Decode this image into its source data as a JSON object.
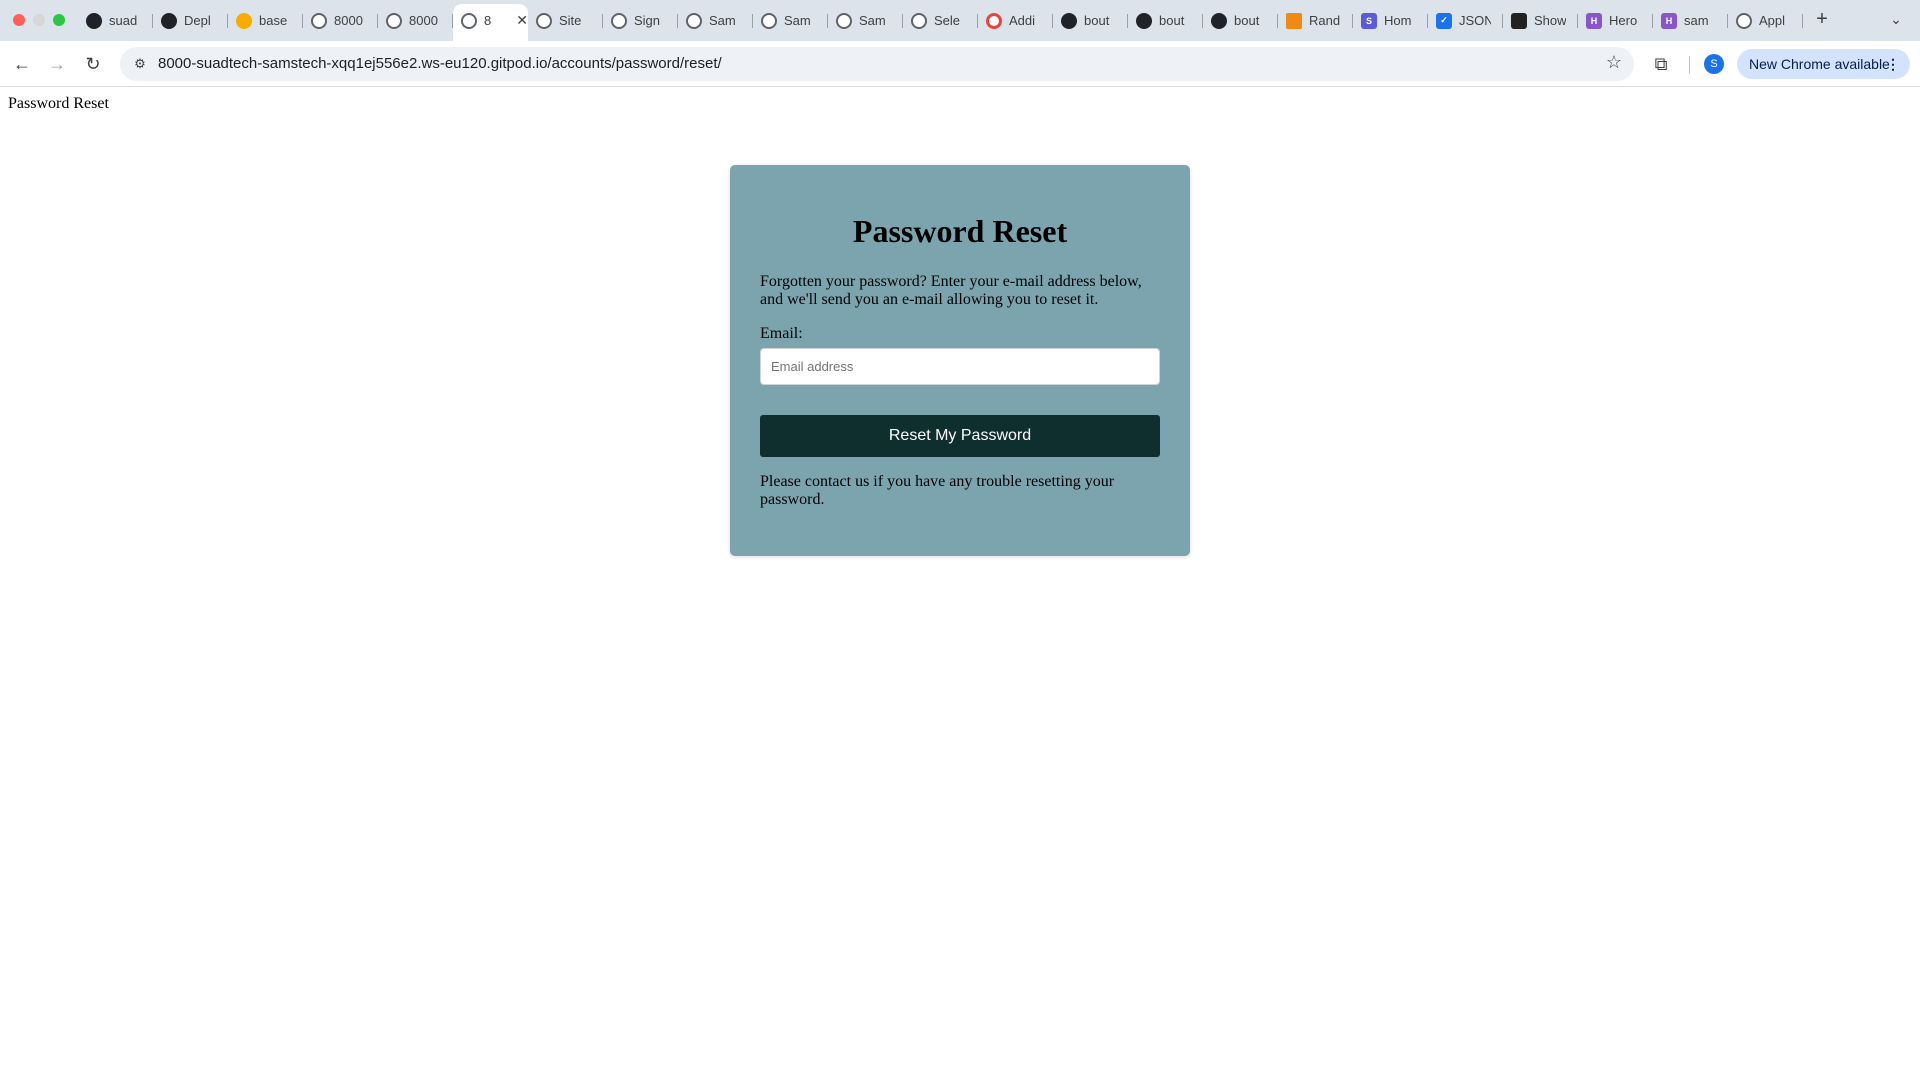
{
  "browser": {
    "tabs": [
      {
        "label": "suad",
        "icon": "github-icon",
        "active": false
      },
      {
        "label": "Depl",
        "icon": "github-icon",
        "active": false
      },
      {
        "label": "base",
        "icon": "firebase-icon",
        "active": false
      },
      {
        "label": "8000",
        "icon": "globe-icon",
        "active": false
      },
      {
        "label": "8000",
        "icon": "globe-icon",
        "active": false
      },
      {
        "label": "8",
        "icon": "globe-icon",
        "active": true
      },
      {
        "label": "Site",
        "icon": "globe-icon",
        "active": false
      },
      {
        "label": "Sign",
        "icon": "globe-icon",
        "active": false
      },
      {
        "label": "Sam",
        "icon": "globe-icon",
        "active": false
      },
      {
        "label": "Sam",
        "icon": "globe-icon",
        "active": false
      },
      {
        "label": "Sam",
        "icon": "globe-icon",
        "active": false
      },
      {
        "label": "Sele",
        "icon": "globe-icon",
        "active": false
      },
      {
        "label": "Addi",
        "icon": "opera-icon",
        "active": false
      },
      {
        "label": "bout",
        "icon": "github-icon",
        "active": false
      },
      {
        "label": "bout",
        "icon": "github-icon",
        "active": false
      },
      {
        "label": "bout",
        "icon": "github-icon",
        "active": false
      },
      {
        "label": "Rand",
        "icon": "random-icon",
        "active": false
      },
      {
        "label": "Hom",
        "icon": "s-icon",
        "active": false
      },
      {
        "label": "JSON",
        "icon": "checkbox-icon",
        "active": false
      },
      {
        "label": "Show",
        "icon": "logo-icon",
        "active": false
      },
      {
        "label": "Hero",
        "icon": "heroku-icon",
        "active": false
      },
      {
        "label": "sam",
        "icon": "heroku-icon",
        "active": false
      },
      {
        "label": "Appl",
        "icon": "globe-icon",
        "active": false
      }
    ],
    "new_tab_label": "+",
    "url": "8000-suadtech-samstech-xqq1ej556e2.ws-eu120.gitpod.io/accounts/password/reset/",
    "avatar_initial": "S",
    "update_label": "New Chrome available",
    "colors": {
      "tabstrip_bg": "#dde3ea",
      "omnibox_bg": "#eef1f6",
      "update_btn_bg": "#d3e3fd"
    }
  },
  "page": {
    "heading": "Password Reset",
    "card": {
      "title": "Password Reset",
      "intro": "Forgotten your password? Enter your e-mail address below, and we'll send you an e-mail allowing you to reset it.",
      "email_label": "Email:",
      "email_placeholder": "Email address",
      "email_value": "",
      "submit_label": "Reset My Password",
      "help_text": "Please contact us if you have any trouble resetting your password."
    },
    "colors": {
      "card_bg": "#7ba4ae",
      "button_bg": "#0f2e2e",
      "button_text": "#ffffff"
    }
  }
}
